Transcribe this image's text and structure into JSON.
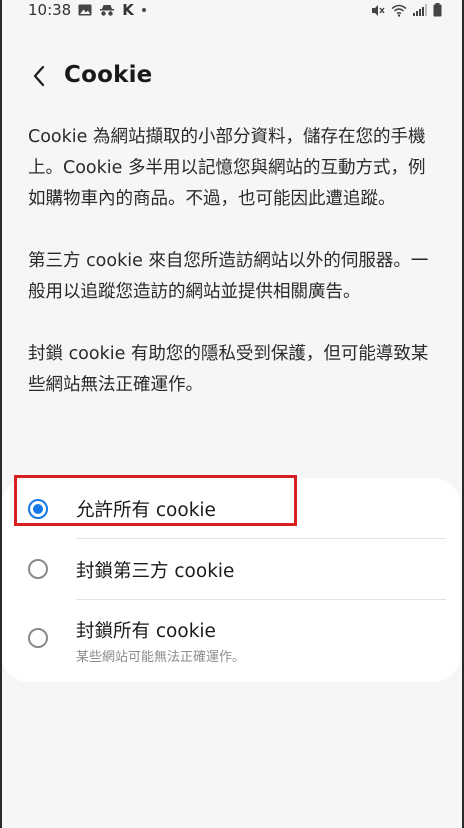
{
  "status_bar": {
    "time": "10:38",
    "left_icons": [
      "image-icon",
      "incognito-icon",
      "k-icon",
      "dot-icon"
    ],
    "k_glyph": "K",
    "right_icons": [
      "mute-icon",
      "wifi-icon",
      "signal-icon",
      "battery-icon"
    ]
  },
  "header": {
    "title": "Cookie",
    "back_icon": "chevron-left-icon"
  },
  "description": {
    "paragraphs": [
      "Cookie 為網站擷取的小部分資料，儲存在您的手機上。Cookie 多半用以記憶您與網站的互動方式，例如購物車內的商品。不過，也可能因此遭追蹤。",
      "第三方 cookie 來自您所造訪網站以外的伺服器。一般用以追蹤您造訪的網站並提供相關廣告。",
      "封鎖 cookie 有助您的隱私受到保護，但可能導致某些網站無法正確運作。"
    ]
  },
  "options": [
    {
      "label": "允許所有 cookie",
      "selected": true,
      "sublabel": ""
    },
    {
      "label": "封鎖第三方 cookie",
      "selected": false,
      "sublabel": ""
    },
    {
      "label": "封鎖所有 cookie",
      "selected": false,
      "sublabel": "某些網站可能無法正確運作。"
    }
  ],
  "colors": {
    "accent": "#1677e8",
    "highlight": "#d81e1e",
    "card_bg": "#ffffff",
    "page_bg": "#f6f6f6"
  }
}
